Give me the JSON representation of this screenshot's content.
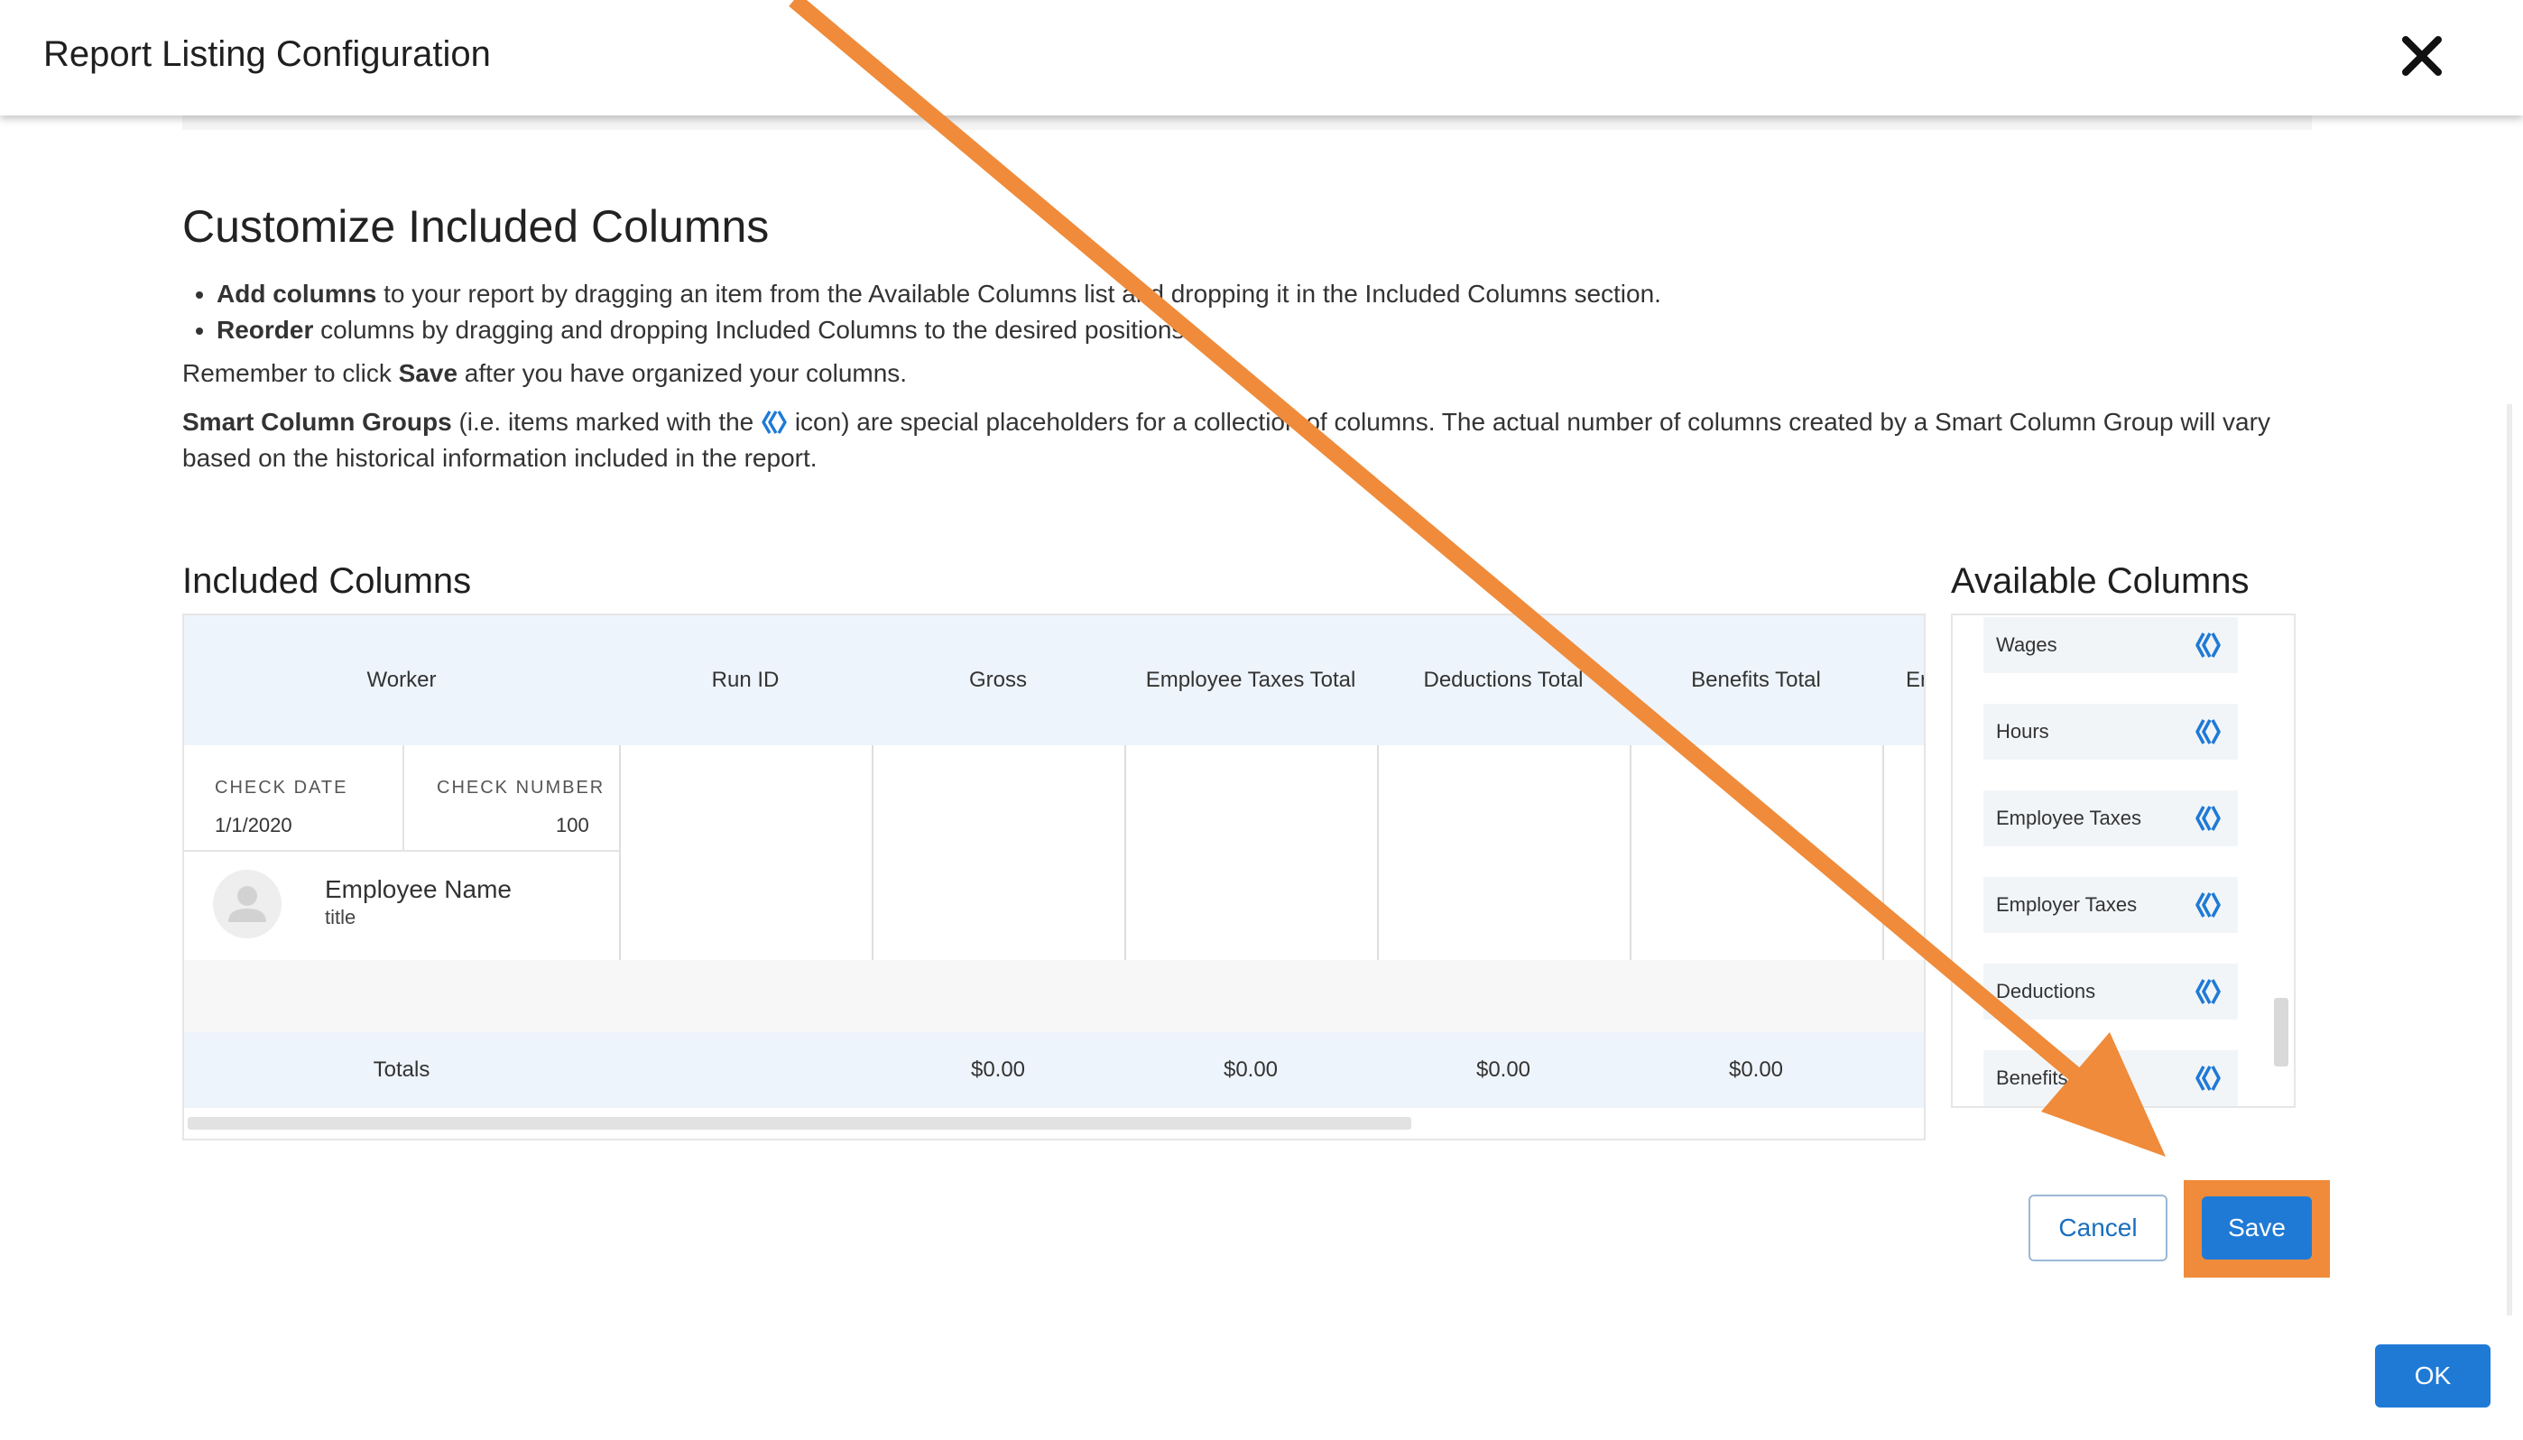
{
  "header": {
    "title": "Report Listing Configuration"
  },
  "customize": {
    "heading": "Customize Included Columns",
    "bullet1_bold": "Add columns",
    "bullet1_rest": " to your report by dragging an item from the Available Columns list and dropping it in the Included Columns section.",
    "bullet2_bold": "Reorder",
    "bullet2_rest": " columns by dragging and dropping Included Columns to the desired positions.",
    "remember_pre": "Remember to click ",
    "remember_bold": "Save",
    "remember_post": " after you have organized your columns.",
    "smart_bold": "Smart Column Groups",
    "smart_pre": " (i.e. items marked with the ",
    "smart_post": " icon) are special placeholders for a collection of columns. The actual number of columns created by a Smart Column Group will vary based on the historical information included in the report."
  },
  "included": {
    "title": "Included Columns",
    "columns": [
      "Worker",
      "Run ID",
      "Gross",
      "Employee Taxes Total",
      "Deductions Total",
      "Benefits Total",
      "Er"
    ],
    "check_date_label": "CHECK DATE",
    "check_date_value": "1/1/2020",
    "check_number_label": "CHECK NUMBER",
    "check_number_value": "100",
    "employee_name": "Employee Name",
    "employee_title": "title",
    "totals_label": "Totals",
    "totals": [
      "",
      "$0.00",
      "$0.00",
      "$0.00",
      "$0.00"
    ]
  },
  "available": {
    "title": "Available Columns",
    "items": [
      "Wages",
      "Hours",
      "Employee Taxes",
      "Employer Taxes",
      "Deductions",
      "Benefits"
    ]
  },
  "buttons": {
    "cancel": "Cancel",
    "save": "Save",
    "ok": "OK"
  },
  "colors": {
    "accent": "#1f7ad6",
    "annotation": "#ef8b3a",
    "header_bg": "#eef4fb"
  }
}
